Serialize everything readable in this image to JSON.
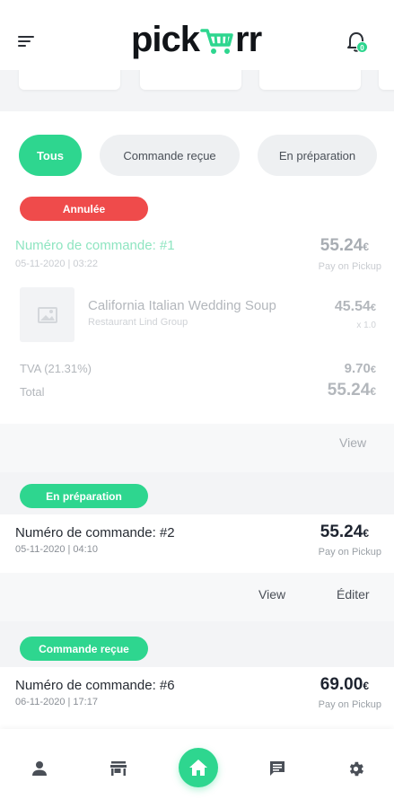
{
  "app": {
    "logo_prefix": "pick",
    "logo_suffix": "rr",
    "notification_count": "0"
  },
  "filters": [
    {
      "label": "Tous",
      "active": true
    },
    {
      "label": "Commande reçue",
      "active": false
    },
    {
      "label": "En préparation",
      "active": false
    }
  ],
  "orders": [
    {
      "status": "Annulée",
      "status_color": "#ef4b4b",
      "title": "Numéro de commande: #1",
      "date": "05-11-2020 | 03:22",
      "amount": "55.24",
      "currency": "€",
      "payment": "Pay on Pickup",
      "item": {
        "name": "California Italian Wedding Soup",
        "restaurant": "Restaurant Lind Group",
        "price": "45.54",
        "qty": "x 1.0"
      },
      "tax_label": "TVA (21.31%)",
      "tax_value": "9.70",
      "total_label": "Total",
      "total_value": "55.24",
      "actions": [
        "View"
      ]
    },
    {
      "status": "En préparation",
      "status_color": "#2ed68f",
      "title": "Numéro de commande: #2",
      "date": "05-11-2020 | 04:10",
      "amount": "55.24",
      "currency": "€",
      "payment": "Pay on Pickup",
      "actions": [
        "View",
        "Éditer"
      ]
    },
    {
      "status": "Commande reçue",
      "status_color": "#2ed68f",
      "title": "Numéro de commande: #6",
      "date": "06-11-2020 | 17:17",
      "amount": "69.00",
      "currency": "€",
      "payment": "Pay on Pickup"
    }
  ],
  "colors": {
    "accent": "#2ed68f",
    "danger": "#ef4b4b"
  },
  "nav": {
    "items": [
      "profile-icon",
      "store-icon",
      "home-icon",
      "chat-icon",
      "settings-icon"
    ]
  }
}
